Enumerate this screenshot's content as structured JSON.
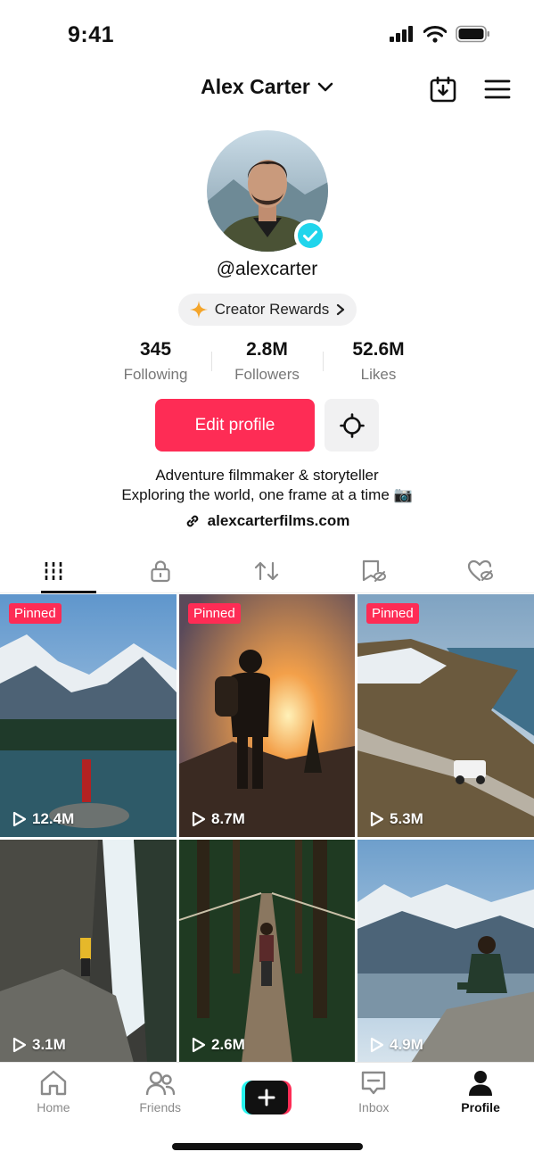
{
  "status_bar": {
    "time": "9:41",
    "icons": [
      "signal-icon",
      "wifi-icon",
      "battery-icon"
    ]
  },
  "header": {
    "account_name": "Alex Carter",
    "icons": [
      "chevron-down-icon",
      "calendar-download-icon",
      "menu-icon"
    ]
  },
  "profile": {
    "username": "@alexcarter",
    "verified": true,
    "rewards_label": "Creator Rewards",
    "stats": [
      {
        "value": "345",
        "label": "Following"
      },
      {
        "value": "2.8M",
        "label": "Followers"
      },
      {
        "value": "52.6M",
        "label": "Likes"
      }
    ],
    "edit_label": "Edit profile",
    "bio_line1": "Adventure filmmaker & storyteller",
    "bio_line2": "Exploring the world, one frame at a time 📷",
    "link": "alexcarterfilms.com"
  },
  "tabs": [
    {
      "icon": "videos-grid-icon",
      "active": true
    },
    {
      "icon": "lock-icon",
      "active": false
    },
    {
      "icon": "repost-icon",
      "active": false
    },
    {
      "icon": "bookmark-hidden-icon",
      "active": false
    },
    {
      "icon": "liked-hidden-icon",
      "active": false
    }
  ],
  "videos": [
    {
      "pinned": "Pinned",
      "views": "12.4M",
      "scene": "mountain-lake"
    },
    {
      "pinned": "Pinned",
      "views": "8.7M",
      "scene": "sunset-hiker"
    },
    {
      "pinned": "Pinned",
      "views": "5.3M",
      "scene": "coastal-road"
    },
    {
      "pinned": "",
      "views": "3.1M",
      "scene": "waterfall"
    },
    {
      "pinned": "",
      "views": "2.6M",
      "scene": "forest-bridge"
    },
    {
      "pinned": "",
      "views": "4.9M",
      "scene": "mountain-view"
    }
  ],
  "bottom_nav": [
    {
      "label": "Home",
      "icon": "home-icon",
      "active": false
    },
    {
      "label": "Friends",
      "icon": "friends-icon",
      "active": false
    },
    {
      "label": "",
      "icon": "create-icon",
      "active": false
    },
    {
      "label": "Inbox",
      "icon": "inbox-icon",
      "active": false
    },
    {
      "label": "Profile",
      "icon": "profile-icon",
      "active": true
    }
  ],
  "colors": {
    "accent": "#fe2c55",
    "secondary_accent": "#25f4ee",
    "verified": "#20d5ec",
    "muted_text": "#777777"
  }
}
